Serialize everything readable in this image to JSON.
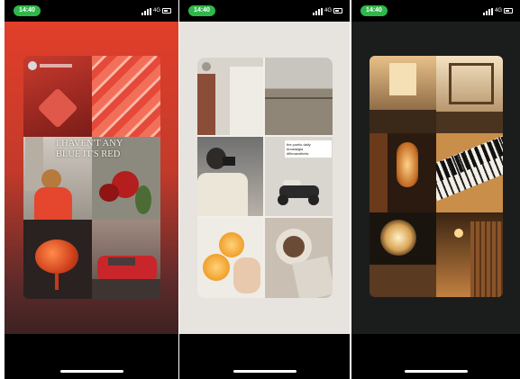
{
  "screens": [
    {
      "status": {
        "time": "14:40",
        "network": "4G"
      },
      "colors": {
        "bg_top": "#e5402a",
        "bg_bottom": "#2a1c1e"
      },
      "collage_text": "I HAVEN'T ANY\nBLUE IT'S RED"
    },
    {
      "status": {
        "time": "14:40",
        "network": "4G"
      },
      "colors": {
        "bg": "#e7e4df"
      },
      "sticker_text": "the poetic daily\n#nostalgia\n#filmaesthetic"
    },
    {
      "status": {
        "time": "14:40",
        "network": "4G"
      },
      "colors": {
        "bg": "#1b1d1c"
      }
    }
  ]
}
